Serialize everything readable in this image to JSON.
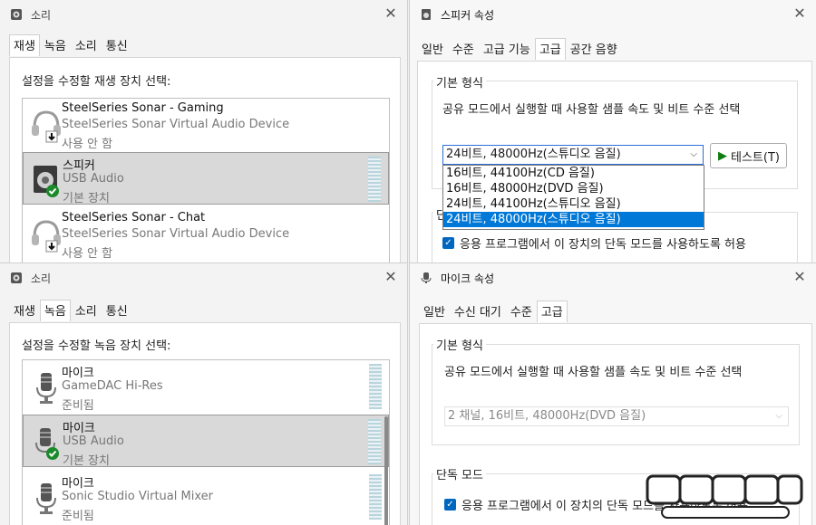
{
  "sound_playback": {
    "title": "소리",
    "tabs": [
      "재생",
      "녹음",
      "소리",
      "통신"
    ],
    "active_tab": 0,
    "instruction": "설정을 수정할 재생 장치 선택:",
    "devices": [
      {
        "name": "SteelSeries Sonar - Gaming",
        "desc": "SteelSeries Sonar Virtual Audio Device",
        "status": "사용 안 함",
        "icon": "headset-icon",
        "selected": false
      },
      {
        "name": "스피커",
        "desc": "USB Audio",
        "status": "기본 장치",
        "icon": "speaker-icon",
        "selected": true
      },
      {
        "name": "SteelSeries Sonar - Chat",
        "desc": "SteelSeries Sonar Virtual Audio Device",
        "status": "사용 안 함",
        "icon": "headset-icon",
        "selected": false
      }
    ]
  },
  "sound_recording": {
    "title": "소리",
    "tabs": [
      "재생",
      "녹음",
      "소리",
      "통신"
    ],
    "active_tab": 1,
    "instruction": "설정을 수정할 녹음 장치 선택:",
    "devices": [
      {
        "name": "마이크",
        "desc": "GameDAC Hi-Res",
        "status": "준비됨",
        "icon": "microphone-icon",
        "selected": false
      },
      {
        "name": "마이크",
        "desc": "USB Audio",
        "status": "기본 장치",
        "icon": "microphone-icon",
        "selected": true
      },
      {
        "name": "마이크",
        "desc": "Sonic Studio Virtual Mixer",
        "status": "준비됨",
        "icon": "microphone-icon",
        "selected": false
      }
    ]
  },
  "speaker_props": {
    "title": "스피커 속성",
    "tabs": [
      "일반",
      "수준",
      "고급 기능",
      "고급",
      "공간 음향"
    ],
    "active_tab": 3,
    "default_format_label": "기본 형식",
    "default_format_desc": "공유 모드에서 실행할 때 사용할 샘플 속도 및 비트 수준 선택",
    "selected_format": "24비트, 48000Hz(스튜디오 음질)",
    "format_options": [
      "16비트, 44100Hz(CD 음질)",
      "16비트, 48000Hz(DVD 음질)",
      "24비트, 44100Hz(스튜디오 음질)",
      "24비트, 48000Hz(스튜디오 음질)"
    ],
    "highlighted_option": 3,
    "test_button": "테스트(T)",
    "exclusive_label_partial": "단",
    "exclusive_allow": "응용 프로그램에서 이 장치의 단독 모드를 사용하도록 허용"
  },
  "mic_props": {
    "title": "마이크 속성",
    "tabs": [
      "일반",
      "수신 대기",
      "수준",
      "고급"
    ],
    "active_tab": 3,
    "default_format_label": "기본 형식",
    "default_format_desc": "공유 모드에서 실행할 때 사용할 샘플 속도 및 비트 수준 선택",
    "selected_format": "2 채널, 16비트, 48000Hz(DVD 음질)",
    "exclusive_label": "단독 모드",
    "exclusive_allow": "응용 프로그램에서 이 장치의 단독 모드를 사용하도록 허용"
  },
  "colors": {
    "accent": "#0067c0",
    "highlight": "#0078d7",
    "selected_row": "#d9d9d9",
    "meter": "#b8d4dd"
  }
}
